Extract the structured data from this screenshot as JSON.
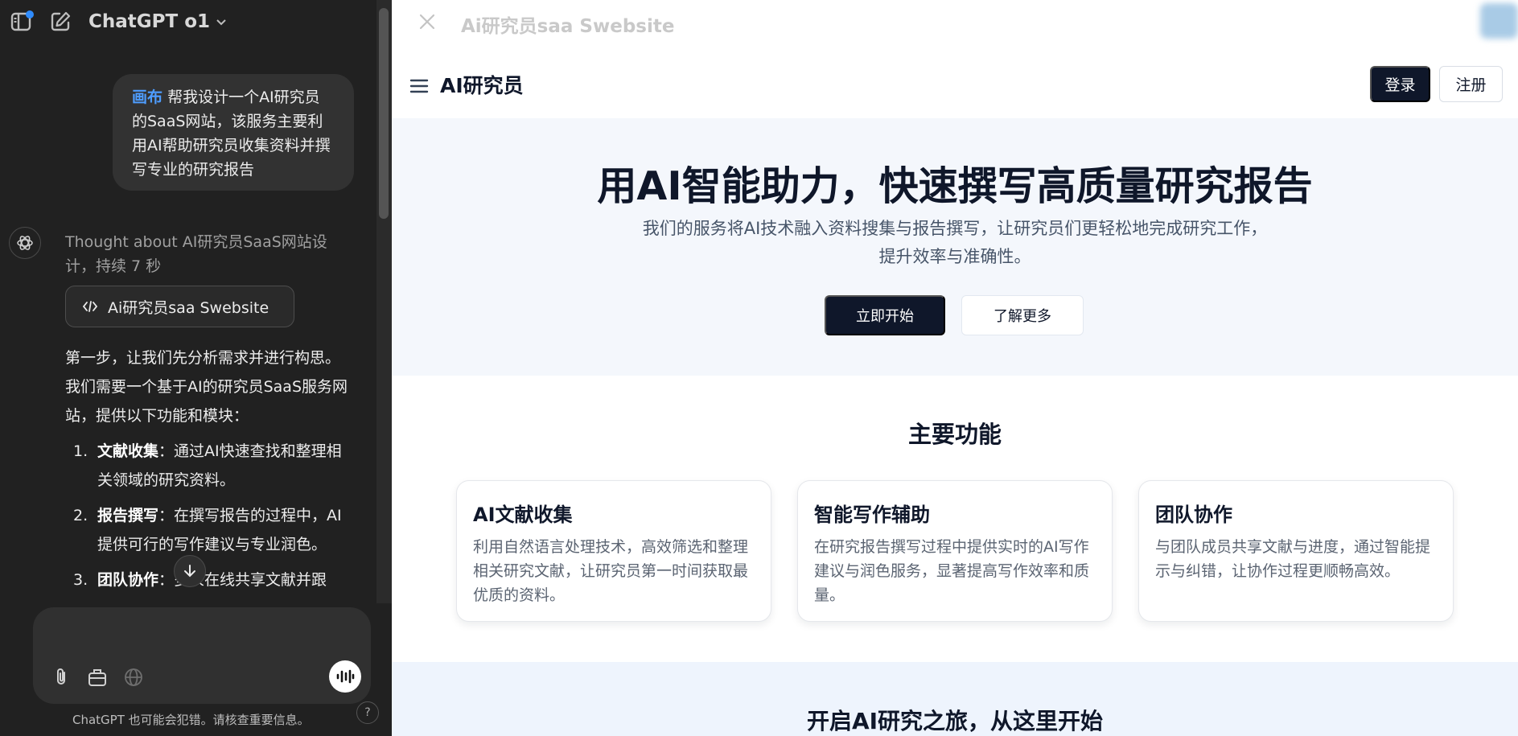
{
  "chat": {
    "model_name": "ChatGPT o1",
    "user_message": {
      "tag": "画布",
      "text": "帮我设计一个AI研究员的SaaS网站，该服务主要利用AI帮助研究员收集资料并撰写专业的研究报告"
    },
    "thought": "Thought about AI研究员SaaS网站设计，持续 7 秒",
    "canvas_chip_label": "Ai研究员saa Swebsite",
    "answer_intro": "第一步，让我们先分析需求并进行构思。我们需要一个基于AI的研究员SaaS服务网站，提供以下功能和模块：",
    "answer_items": [
      {
        "num": "1.",
        "title": "文献收集",
        "text": "：通过AI快速查找和整理相关领域的研究资料。"
      },
      {
        "num": "2.",
        "title": "报告撰写",
        "text": "：在撰写报告的过程中，AI提供可行的写作建议与专业润色。"
      },
      {
        "num": "3.",
        "title": "团队协作",
        "text": "：多人在线共享文献并跟"
      }
    ],
    "input_placeholder": "",
    "disclaimer": "ChatGPT 也可能会犯错。请核查重要信息。",
    "help_label": "?",
    "icons": [
      "sidebar-toggle-icon",
      "new-chat-icon",
      "chevron-down-icon",
      "openai-logo-icon",
      "code-icon",
      "arrow-down-icon",
      "paperclip-icon",
      "toolbox-icon",
      "globe-icon",
      "voice-wave-icon",
      "close-icon",
      "menu-icon"
    ]
  },
  "canvas": {
    "title": "Ai研究员saa Swebsite",
    "site": {
      "brand": "AI研究员",
      "login": "登录",
      "signup": "注册",
      "hero_title": "用AI智能助力，快速撰写高质量研究报告",
      "hero_sub_line1": "我们的服务将AI技术融入资料搜集与报告撰写，让研究员们更轻松地完成研究工作，",
      "hero_sub_line2": "提升效率与准确性。",
      "start_button": "立即开始",
      "learn_button": "了解更多",
      "features_title": "主要功能",
      "features": [
        {
          "title": "AI文献收集",
          "desc": "利用自然语言处理技术，高效筛选和整理相关研究文献，让研究员第一时间获取最优质的资料。"
        },
        {
          "title": "智能写作辅助",
          "desc": "在研究报告撰写过程中提供实时的AI写作建议与润色服务，显著提高写作效率和质量。"
        },
        {
          "title": "团队协作",
          "desc": "与团队成员共享文献与进度，通过智能提示与纠错，让协作过程更顺畅高效。"
        }
      ],
      "cta_title": "开启AI研究之旅，从这里开始"
    }
  },
  "colors": {
    "chat_bg": "#212121",
    "bubble_bg": "#323232",
    "accent_blue": "#4e9dff",
    "site_dark": "#0f172a",
    "hero_bg": "#f4f7fc",
    "cta_bg": "#eef4fd"
  }
}
